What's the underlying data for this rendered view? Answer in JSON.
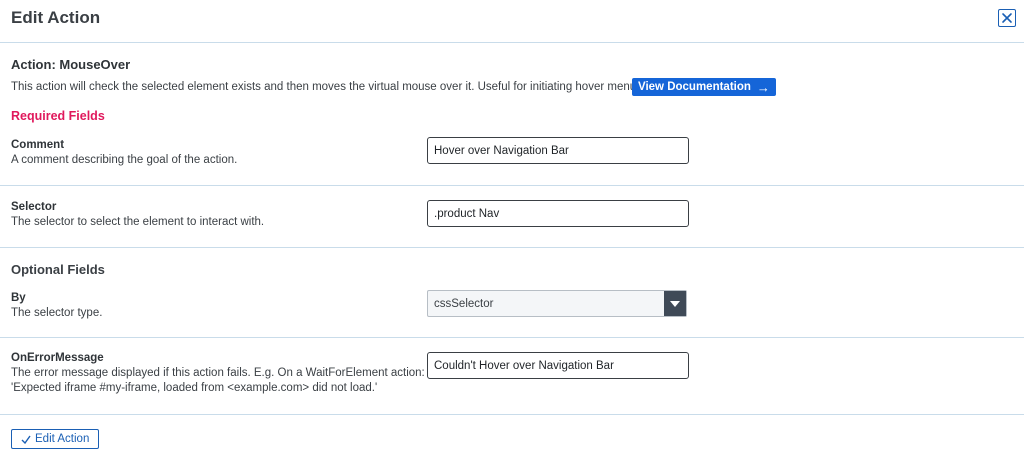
{
  "header": {
    "title": "Edit Action"
  },
  "action": {
    "title": "Action: MouseOver",
    "description": "This action will check the selected element exists and then moves the virtual mouse over it. Useful for initiating hover menus.",
    "doc_button_label": "View Documentation"
  },
  "required": {
    "heading": "Required Fields",
    "comment": {
      "label": "Comment",
      "help": "A comment describing the goal of the action.",
      "value": "Hover over Navigation Bar"
    },
    "selector": {
      "label": "Selector",
      "help": "The selector to select the element to interact with.",
      "value": ".product Nav"
    }
  },
  "optional": {
    "heading": "Optional Fields",
    "by": {
      "label": "By",
      "help": "The selector type.",
      "selected": "cssSelector"
    },
    "on_error": {
      "label": "OnErrorMessage",
      "help_line1": "The error message displayed if this action fails. E.g. On a WaitForElement action:",
      "help_line2": "'Expected iframe #my-iframe, loaded from <example.com> did not load.'",
      "value": "Couldn't Hover over Navigation Bar"
    }
  },
  "footer": {
    "edit_button_label": "Edit Action"
  },
  "colors": {
    "accent": "#1565d8",
    "required": "#e0185c",
    "divider": "#c9dcea"
  }
}
